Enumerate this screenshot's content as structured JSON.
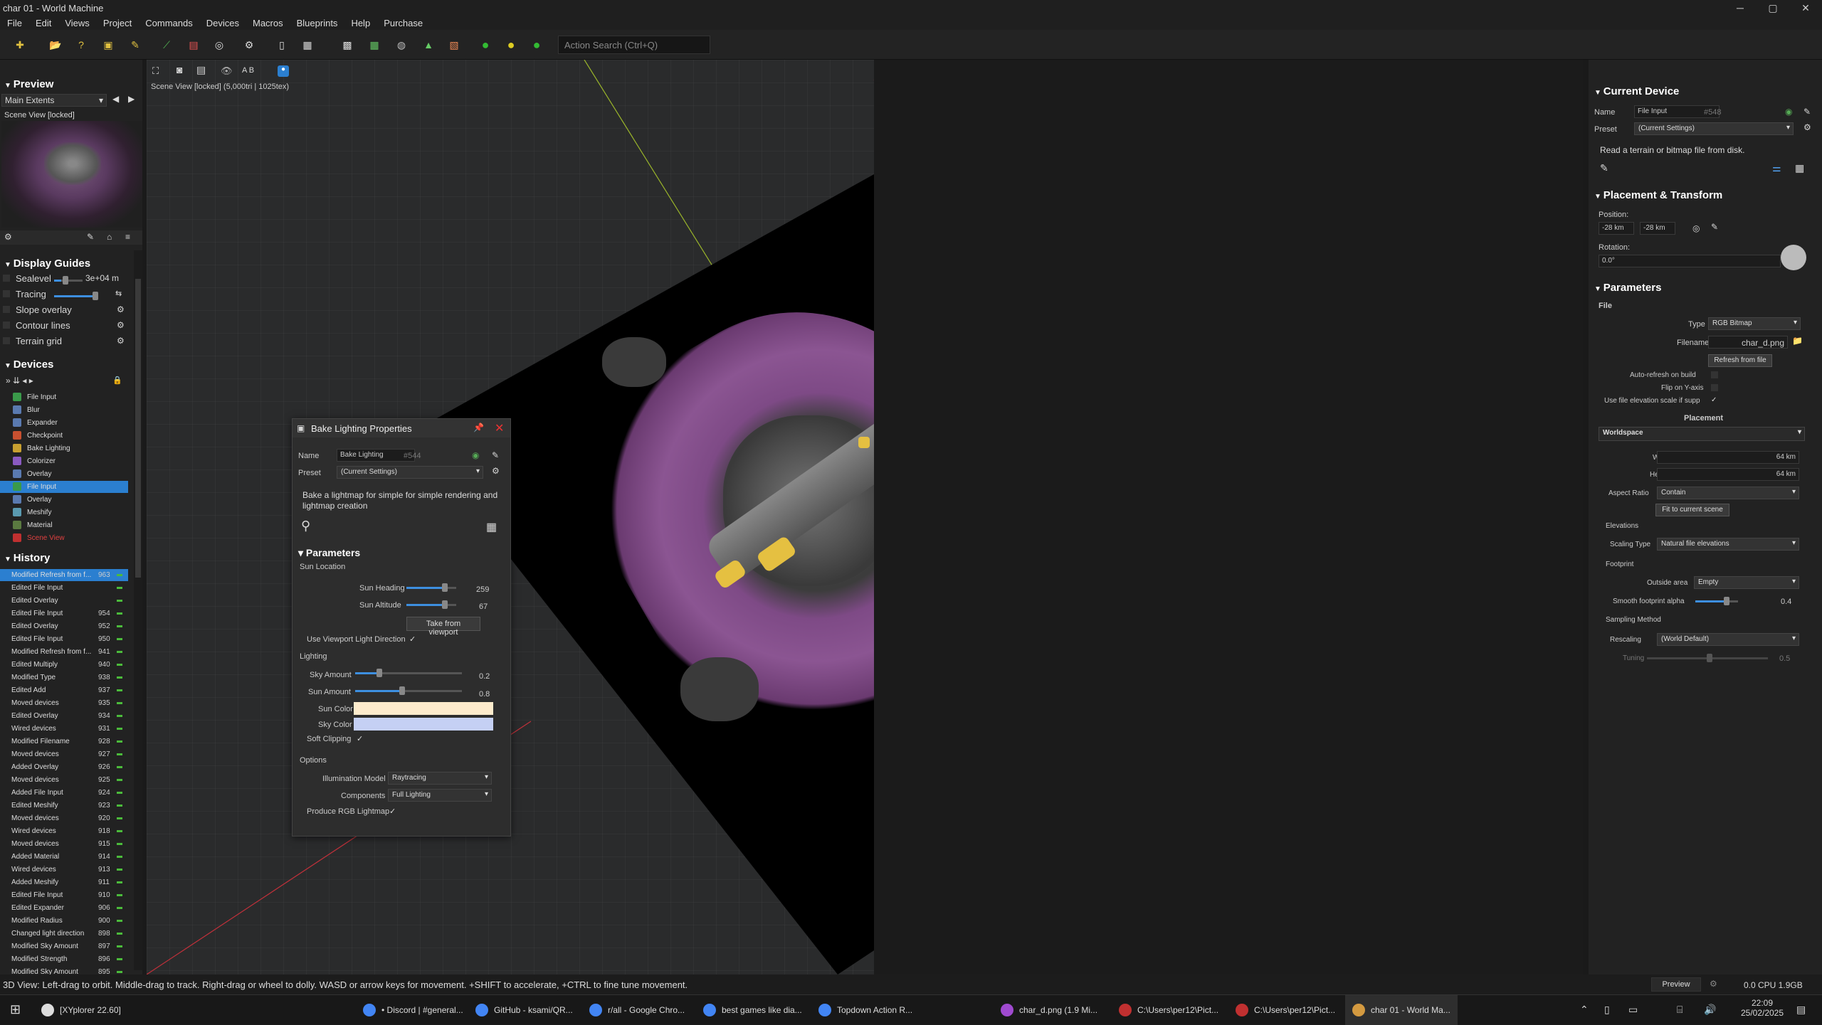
{
  "window": {
    "title": "char 01 - World Machine"
  },
  "menu": [
    "File",
    "Edit",
    "Views",
    "Project",
    "Commands",
    "Devices",
    "Macros",
    "Blueprints",
    "Help",
    "Purchase"
  ],
  "toolbar": {
    "search_placeholder": "Action Search (Ctrl+Q)",
    "ab_label": "A B"
  },
  "preview": {
    "title": "Preview",
    "extents": "Main Extents",
    "scene_label": "Scene View [locked]"
  },
  "guides": {
    "title": "Display Guides",
    "sealevel": "Sealevel",
    "sealevel_value": "3e+04 m",
    "tracing": "Tracing",
    "slope": "Slope overlay",
    "contour": "Contour lines",
    "grid": "Terrain grid"
  },
  "devices": {
    "title": "Devices",
    "items": [
      {
        "label": "File Input",
        "color": "#3a9a4a"
      },
      {
        "label": "Blur",
        "color": "#5a7ab0"
      },
      {
        "label": "Expander",
        "color": "#5a7ab0"
      },
      {
        "label": "Checkpoint",
        "color": "#c85030"
      },
      {
        "label": "Bake Lighting",
        "color": "#c8a030"
      },
      {
        "label": "Colorizer",
        "color": "#8a5ac0"
      },
      {
        "label": "Overlay",
        "color": "#5a7ab0"
      },
      {
        "label": "File Input",
        "color": "#3a9a4a"
      },
      {
        "label": "Overlay",
        "color": "#5a7ab0"
      },
      {
        "label": "Meshify",
        "color": "#5a9ab0"
      },
      {
        "label": "Material",
        "color": "#5a7a40"
      },
      {
        "label": "Scene View",
        "color": "#c03030"
      }
    ]
  },
  "history": {
    "title": "History",
    "items": [
      {
        "label": "Modified Refresh from f...",
        "num": "963"
      },
      {
        "label": "Edited File Input",
        "num": ""
      },
      {
        "label": "Edited Overlay",
        "num": ""
      },
      {
        "label": "Edited File Input",
        "num": "954"
      },
      {
        "label": "Edited Overlay",
        "num": "952"
      },
      {
        "label": "Edited File Input",
        "num": "950"
      },
      {
        "label": "Modified Refresh from f...",
        "num": "941"
      },
      {
        "label": "Edited Multiply",
        "num": "940"
      },
      {
        "label": "Modified Type",
        "num": "938"
      },
      {
        "label": "Edited Add",
        "num": "937"
      },
      {
        "label": "Moved devices",
        "num": "935"
      },
      {
        "label": "Edited Overlay",
        "num": "934"
      },
      {
        "label": "Wired devices",
        "num": "931"
      },
      {
        "label": "Modified Filename",
        "num": "928"
      },
      {
        "label": "Moved devices",
        "num": "927"
      },
      {
        "label": "Added Overlay",
        "num": "926"
      },
      {
        "label": "Moved devices",
        "num": "925"
      },
      {
        "label": "Added File Input",
        "num": "924"
      },
      {
        "label": "Edited Meshify",
        "num": "923"
      },
      {
        "label": "Moved devices",
        "num": "920"
      },
      {
        "label": "Wired devices",
        "num": "918"
      },
      {
        "label": "Moved devices",
        "num": "915"
      },
      {
        "label": "Added Material",
        "num": "914"
      },
      {
        "label": "Wired devices",
        "num": "913"
      },
      {
        "label": "Added Meshify",
        "num": "911"
      },
      {
        "label": "Edited File Input",
        "num": "910"
      },
      {
        "label": "Edited Expander",
        "num": "906"
      },
      {
        "label": "Modified Radius",
        "num": "900"
      },
      {
        "label": "Changed light direction",
        "num": "898"
      },
      {
        "label": "Modified Sky Amount",
        "num": "897"
      },
      {
        "label": "Modified Strength",
        "num": "896"
      },
      {
        "label": "Modified Sky Amount",
        "num": "895"
      }
    ]
  },
  "viewport": {
    "info": "Scene View [locked] (5,000tri | 1025tex)"
  },
  "dialog": {
    "title": "Bake Lighting Properties",
    "name_label": "Name",
    "name_value": "Bake Lighting",
    "id": "#544",
    "preset_label": "Preset",
    "preset_value": "(Current Settings)",
    "description": "Bake a lightmap for simple for simple rendering and lightmap creation",
    "params": "Parameters",
    "sun_location": "Sun Location",
    "sun_heading": "Sun Heading",
    "sun_heading_value": "259",
    "sun_altitude": "Sun Altitude",
    "sun_altitude_value": "67",
    "take_from_viewport": "Take from viewport",
    "use_viewport": "Use Viewport Light Direction",
    "lighting": "Lighting",
    "sky_amount": "Sky Amount",
    "sky_amount_value": "0.2",
    "sun_amount": "Sun Amount",
    "sun_amount_value": "0.8",
    "sun_color": "Sun Color",
    "sky_color": "Sky Color",
    "soft_clipping": "Soft Clipping",
    "options": "Options",
    "illum": "Illumination Model",
    "illum_value": "Raytracing",
    "components": "Components",
    "components_value": "Full Lighting",
    "produce_rgb": "Produce RGB Lightmap",
    "check": "✓"
  },
  "current": {
    "title": "Current Device",
    "name_label": "Name",
    "name_value": "File Input",
    "id": "#548",
    "preset_label": "Preset",
    "preset_value": "(Current Settings)",
    "description": "Read a terrain or bitmap file from disk.",
    "placement_title": "Placement & Transform",
    "position": "Position:",
    "pos_x": "-28 km",
    "pos_y": "-28 km",
    "rotation": "Rotation:",
    "rotation_value": "0.0°",
    "params": "Parameters",
    "file": "File",
    "type_label": "Type",
    "type_value": "RGB Bitmap",
    "filename_label": "Filename",
    "filename_value": "char_d.png",
    "refresh": "Refresh from file",
    "auto_refresh": "Auto-refresh on build",
    "flip_y": "Flip on Y-axis",
    "use_elev": "Use file elevation scale if supp",
    "placement": "Placement",
    "worldspace": "Worldspace",
    "width_label": "Width",
    "width_value": "64 km",
    "height_label": "Height",
    "height_value": "64 km",
    "aspect_label": "Aspect Ratio",
    "aspect_value": "Contain",
    "fit": "Fit to current scene",
    "elevations": "Elevations",
    "scaling_label": "Scaling Type",
    "scaling_value": "Natural file elevations",
    "footprint": "Footprint",
    "outside_label": "Outside area",
    "outside_value": "Empty",
    "smooth_label": "Smooth footprint alpha",
    "smooth_value": "0.4",
    "sampling": "Sampling Method",
    "rescaling_label": "Rescaling",
    "rescaling_value": "(World Default)",
    "tuning_label": "Tuning",
    "tuning_value": "0.5",
    "check": "✓"
  },
  "status": {
    "text": "3D View: Left-drag to orbit. Middle-drag to track. Right-drag or wheel to dolly. WASD or arrow keys for movement. +SHIFT to accelerate, +CTRL to fine tune movement.",
    "preview_btn": "Preview",
    "cpu": "0.0 CPU 1.9GB"
  },
  "taskbar": {
    "items": [
      "[XYplorer 22.60]",
      "• Discord | #general...",
      "GitHub - ksami/QR...",
      "r/all - Google Chro...",
      "best games like dia...",
      "Topdown Action R...",
      "char_d.png (1.9 Mi...",
      "C:\\Users\\per12\\Pict...",
      "C:\\Users\\per12\\Pict...",
      "char 01 - World Ma..."
    ],
    "time": "22:09",
    "date": "25/02/2025"
  }
}
